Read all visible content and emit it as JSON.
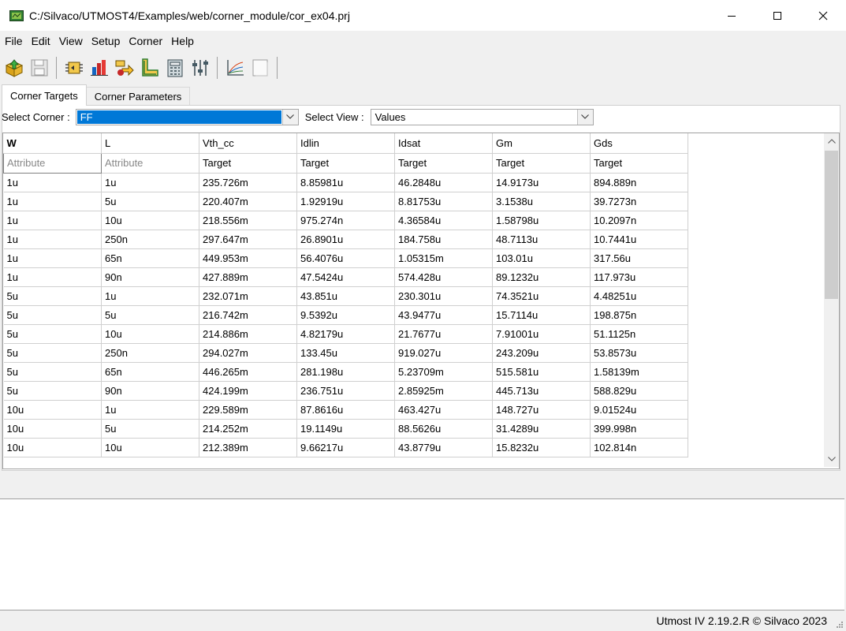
{
  "window": {
    "title": "C:/Silvaco/UTMOST4/Examples/web/corner_module/cor_ex04.prj",
    "minimize_icon": "minimize-icon",
    "maximize_icon": "maximize-icon",
    "close_icon": "close-icon"
  },
  "menu": [
    "File",
    "Edit",
    "View",
    "Setup",
    "Corner",
    "Help"
  ],
  "toolbar": {
    "icons": [
      "open-project-icon",
      "save-icon",
      "circuit-icon",
      "bar-chart-icon",
      "transfer-icon",
      "corner-l-icon",
      "calculator-icon",
      "sliders-icon",
      "plot-icon",
      "blank-page-icon"
    ]
  },
  "tabs": [
    "Corner Targets",
    "Corner Parameters"
  ],
  "controls": {
    "select_corner_label": "Select Corner :",
    "select_corner_value": "FF",
    "select_view_label": "Select View :",
    "select_view_value": "Values"
  },
  "table": {
    "headers": [
      "W",
      "L",
      "Vth_cc",
      "Idlin",
      "Idsat",
      "Gm",
      "Gds"
    ],
    "subheaders": [
      "Attribute",
      "Attribute",
      "Target",
      "Target",
      "Target",
      "Target",
      "Target"
    ],
    "rows": [
      [
        "1u",
        "1u",
        "235.726m",
        "8.85981u",
        "46.2848u",
        "14.9173u",
        "894.889n"
      ],
      [
        "1u",
        "5u",
        "220.407m",
        "1.92919u",
        "8.81753u",
        "3.1538u",
        "39.7273n"
      ],
      [
        "1u",
        "10u",
        "218.556m",
        "975.274n",
        "4.36584u",
        "1.58798u",
        "10.2097n"
      ],
      [
        "1u",
        "250n",
        "297.647m",
        "26.8901u",
        "184.758u",
        "48.7113u",
        "10.7441u"
      ],
      [
        "1u",
        "65n",
        "449.953m",
        "56.4076u",
        "1.05315m",
        "103.01u",
        "317.56u"
      ],
      [
        "1u",
        "90n",
        "427.889m",
        "47.5424u",
        "574.428u",
        "89.1232u",
        "117.973u"
      ],
      [
        "5u",
        "1u",
        "232.071m",
        "43.851u",
        "230.301u",
        "74.3521u",
        "4.48251u"
      ],
      [
        "5u",
        "5u",
        "216.742m",
        "9.5392u",
        "43.9477u",
        "15.7114u",
        "198.875n"
      ],
      [
        "5u",
        "10u",
        "214.886m",
        "4.82179u",
        "21.7677u",
        "7.91001u",
        "51.1125n"
      ],
      [
        "5u",
        "250n",
        "294.027m",
        "133.45u",
        "919.027u",
        "243.209u",
        "53.8573u"
      ],
      [
        "5u",
        "65n",
        "446.265m",
        "281.198u",
        "5.23709m",
        "515.581u",
        "1.58139m"
      ],
      [
        "5u",
        "90n",
        "424.199m",
        "236.751u",
        "2.85925m",
        "445.713u",
        "588.829u"
      ],
      [
        "10u",
        "1u",
        "229.589m",
        "87.8616u",
        "463.427u",
        "148.727u",
        "9.01524u"
      ],
      [
        "10u",
        "5u",
        "214.252m",
        "19.1149u",
        "88.5626u",
        "31.4289u",
        "399.998n"
      ],
      [
        "10u",
        "10u",
        "212.389m",
        "9.66217u",
        "43.8779u",
        "15.8232u",
        "102.814n"
      ]
    ]
  },
  "status": {
    "text": "Utmost IV 2.19.2.R © Silvaco 2023"
  }
}
